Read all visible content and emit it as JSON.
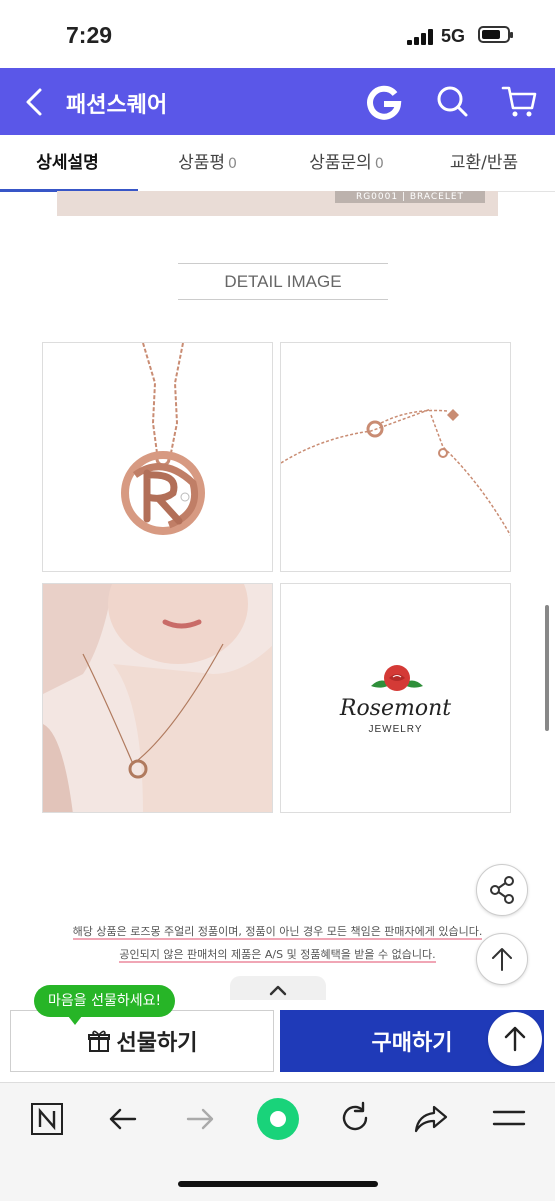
{
  "status": {
    "time": "7:29",
    "network": "5G"
  },
  "appbar": {
    "title": "패션스퀘어"
  },
  "tabs": [
    {
      "label": "상세설명",
      "count": ""
    },
    {
      "label": "상품평",
      "count": "0"
    },
    {
      "label": "상품문의",
      "count": "0"
    },
    {
      "label": "교환/반품",
      "count": ""
    }
  ],
  "banner": {
    "label": "RG0001 | BRACELET"
  },
  "detail_heading": "DETAIL IMAGE",
  "brand": {
    "name": "Rosemont",
    "sub": "JEWELRY"
  },
  "notice": {
    "line1": "해당 상품은 로즈몽 주얼리 정품이며, 정품이 아닌 경우 모든 책임은 판매자에게 있습니다.",
    "line2": "공인되지 않은 판매처의 제품은 A/S 및 정품혜택을 받을 수 없습니다."
  },
  "bottom": {
    "bubble": "마음을 선물하세요!",
    "gift_label": "선물하기",
    "buy_label": "구매하기"
  },
  "colors": {
    "header": "#5a57e8",
    "buy_button": "#1f3ab8",
    "bubble": "#27b527",
    "active_tab_line": "#3856c7"
  }
}
